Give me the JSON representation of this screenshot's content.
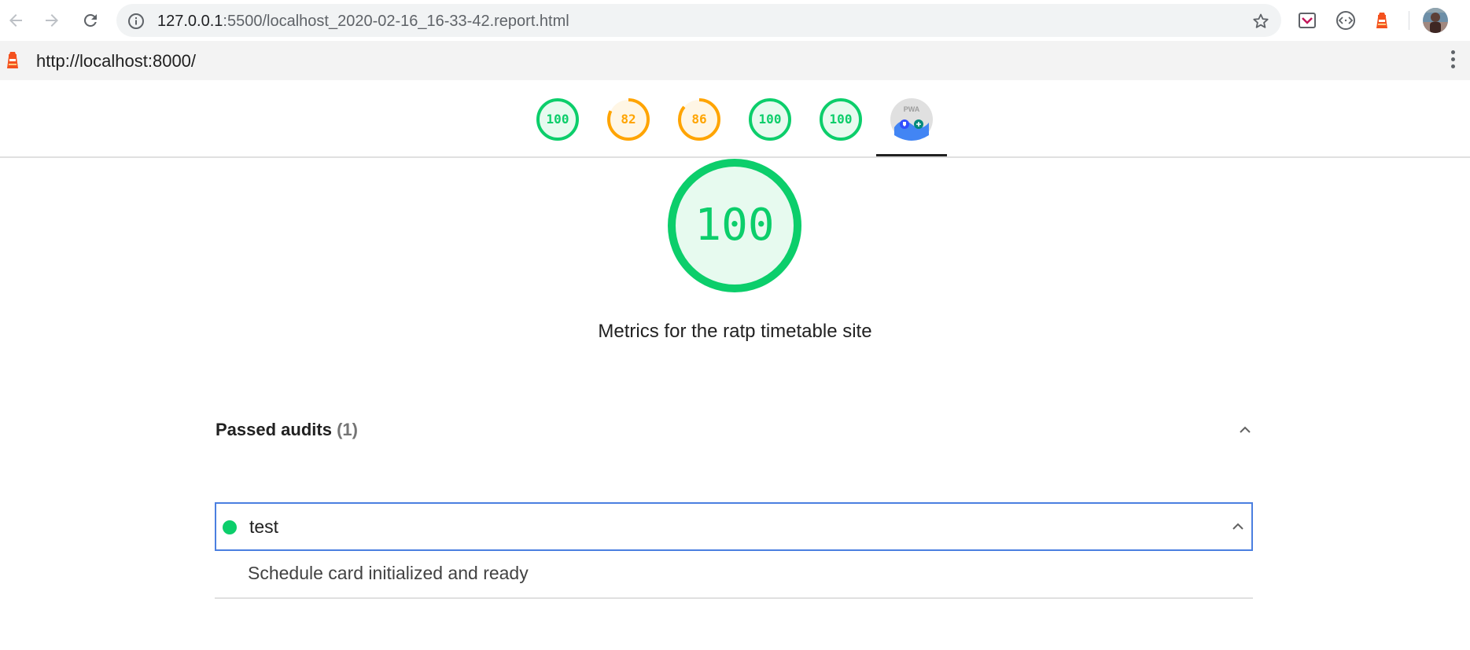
{
  "browser": {
    "url_host": "127.0.0.1",
    "url_path": ":5500/localhost_2020-02-16_16-33-42.report.html",
    "icons": {
      "back": "back-arrow-icon",
      "forward": "forward-arrow-icon",
      "reload": "reload-icon",
      "info": "info-icon",
      "star": "bookmark-star-icon",
      "ext1": "pocket-extension-icon",
      "ext2": "code-extension-icon",
      "ext3": "lighthouse-extension-icon",
      "avatar": "profile-avatar"
    }
  },
  "report": {
    "url": "http://localhost:8000/",
    "gauges": [
      {
        "score": "100",
        "value": 1.0,
        "color": "#0cce6b",
        "bg": "#e7faef"
      },
      {
        "score": "82",
        "value": 0.82,
        "color": "#ffa400",
        "bg": "#fff6e5"
      },
      {
        "score": "86",
        "value": 0.86,
        "color": "#ffa400",
        "bg": "#fff6e5"
      },
      {
        "score": "100",
        "value": 1.0,
        "color": "#0cce6b",
        "bg": "#e7faef"
      },
      {
        "score": "100",
        "value": 1.0,
        "color": "#0cce6b",
        "bg": "#e7faef"
      }
    ],
    "pwa_badge": {
      "label": "PWA"
    },
    "main_score": {
      "score": "100",
      "value": 1.0,
      "color": "#0cce6b",
      "bg": "#e7faef"
    },
    "description": "Metrics for the ratp timetable site",
    "group": {
      "title": "Passed audits",
      "count": "(1)"
    },
    "audit": {
      "title": "test",
      "description": "Schedule card initialized and ready",
      "status_color": "#0cce6b"
    }
  },
  "colors": {
    "pass": "#0cce6b",
    "average": "#ffa400",
    "focus": "#4b7fe0"
  }
}
